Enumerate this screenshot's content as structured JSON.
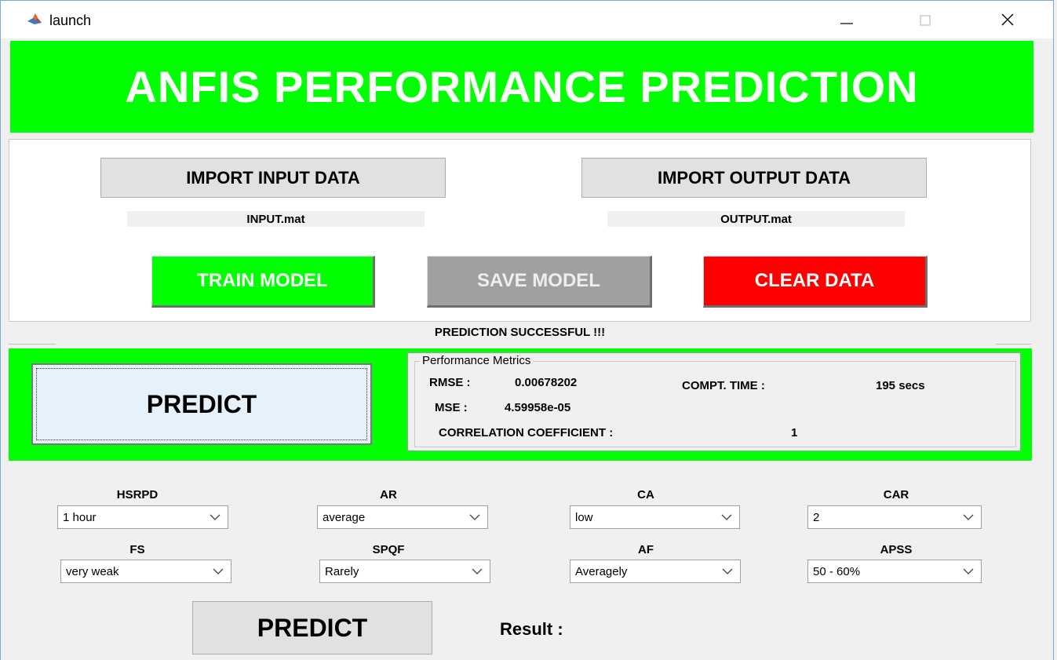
{
  "window": {
    "title": "launch",
    "app_icon": "matlab-icon",
    "controls": [
      "minimize-icon",
      "maximize-icon",
      "close-icon"
    ]
  },
  "banner": {
    "text": "ANFIS PERFORMANCE PREDICTION",
    "color": "#00ff00"
  },
  "import": {
    "input_button": "IMPORT INPUT DATA",
    "output_button": "IMPORT OUTPUT DATA",
    "input_file": "INPUT.mat",
    "output_file": "OUTPUT.mat"
  },
  "actions": {
    "train": {
      "label": "TRAIN MODEL",
      "color": "#00ff00"
    },
    "save": {
      "label": "SAVE MODEL",
      "color": "#a0a0a0"
    },
    "clear": {
      "label": "CLEAR DATA",
      "color": "#ff0000"
    }
  },
  "status": "PREDICTION SUCCESSFUL !!!",
  "predict_main": "PREDICT",
  "metrics": {
    "title": "Performance Metrics",
    "rmse_label": "RMSE :",
    "rmse_value": "0.00678202",
    "mse_label": "MSE :",
    "mse_value": "4.59958e-05",
    "time_label": "COMPT. TIME :",
    "time_value": "195 secs",
    "corr_label": "CORRELATION COEFFICIENT :",
    "corr_value": "1"
  },
  "params": [
    {
      "label": "HSRPD",
      "value": "1 hour"
    },
    {
      "label": "AR",
      "value": "average"
    },
    {
      "label": "CA",
      "value": "low"
    },
    {
      "label": "CAR",
      "value": "2"
    },
    {
      "label": "FS",
      "value": "very weak"
    },
    {
      "label": "SPQF",
      "value": "Rarely"
    },
    {
      "label": "AF",
      "value": "Averagely"
    },
    {
      "label": "APSS",
      "value": "50 - 60%"
    }
  ],
  "predict_bottom": "PREDICT",
  "result_label": "Result :"
}
